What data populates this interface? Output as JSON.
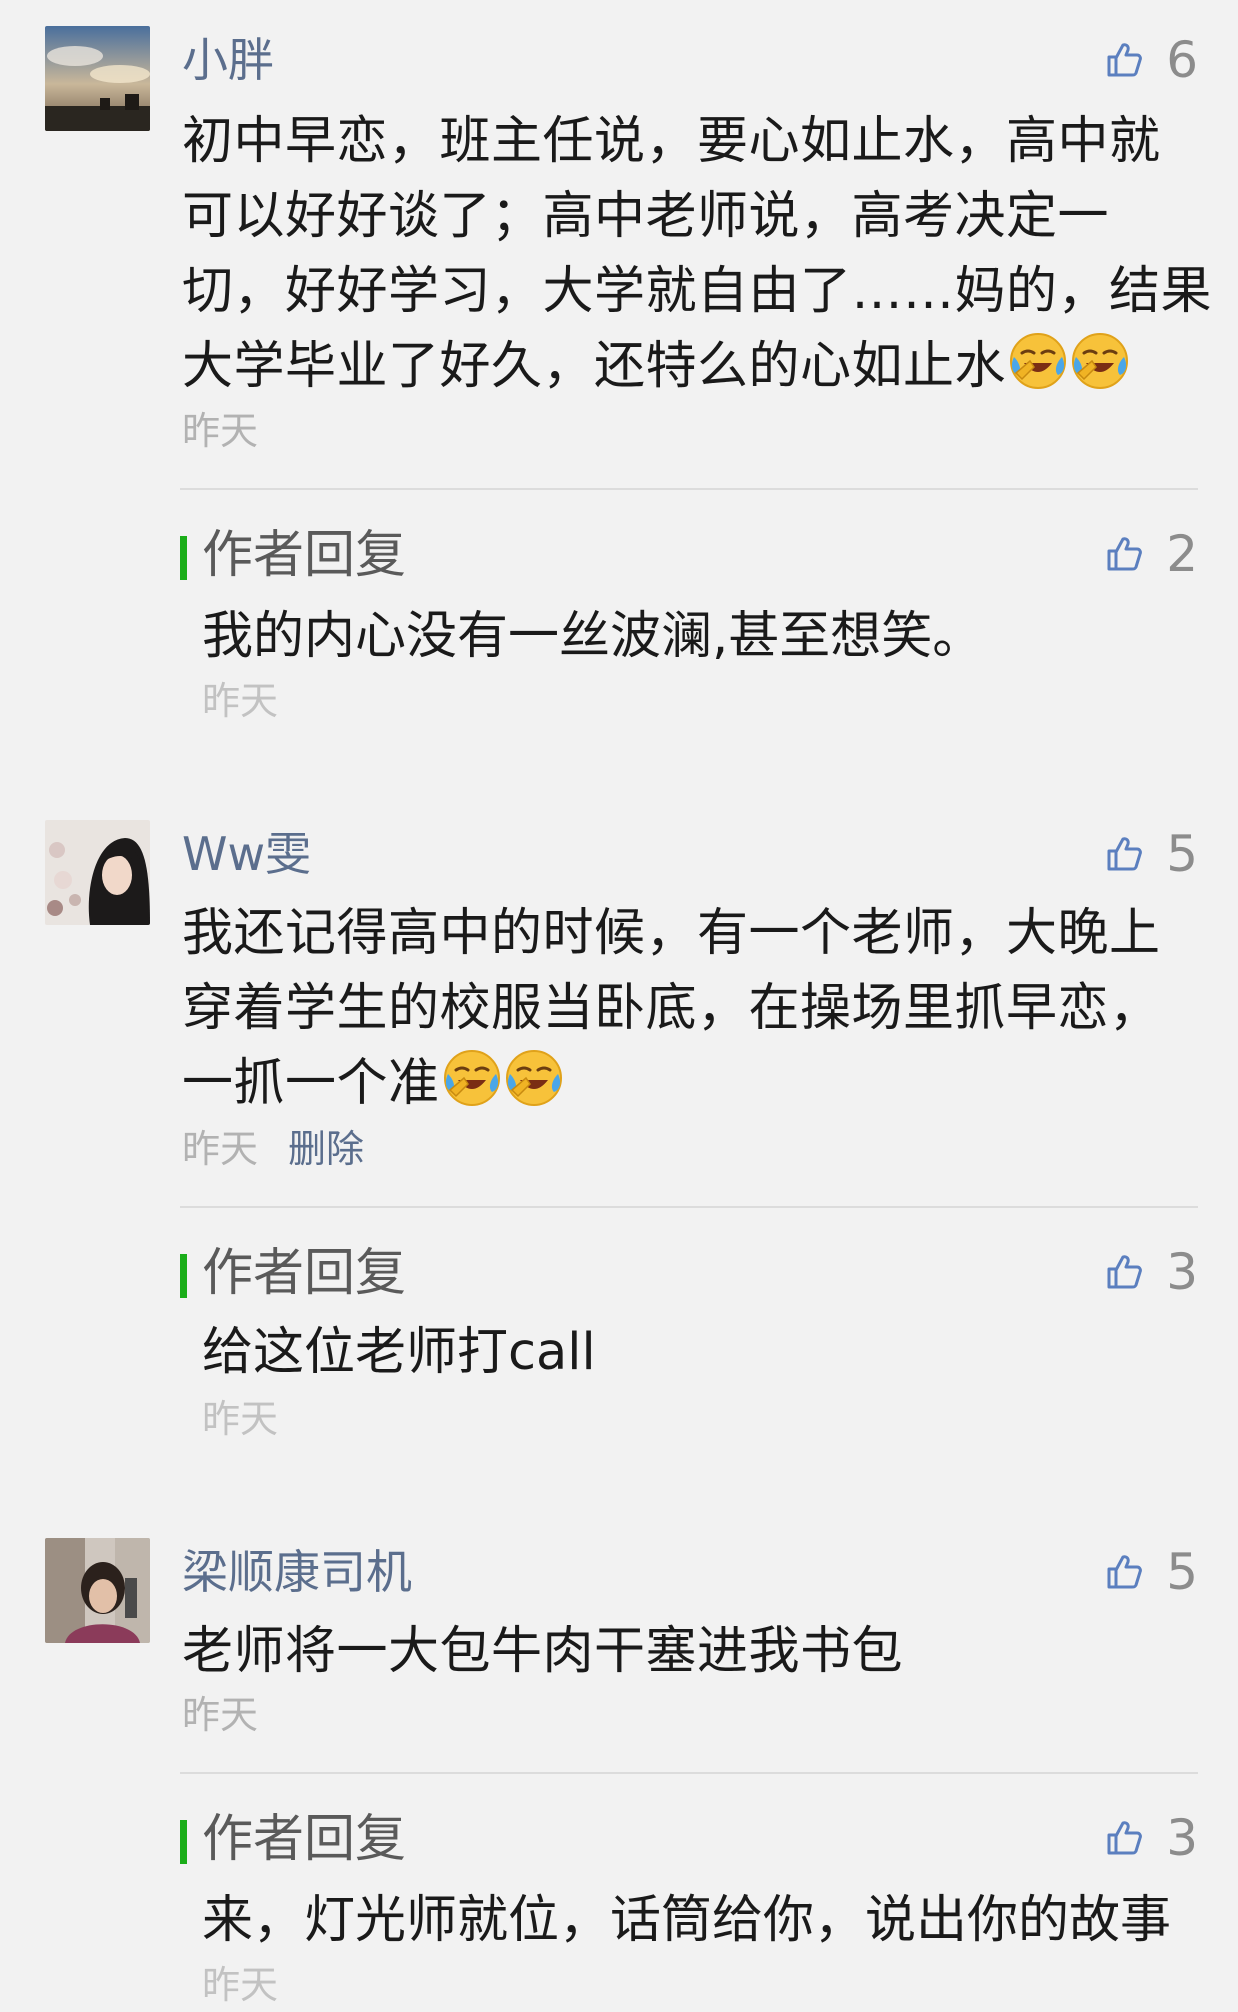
{
  "comments": [
    {
      "name": "小胖",
      "likes": "6",
      "lines": [
        "初中早恋，班主任说，要心如止水，高中就",
        "可以好好谈了；高中老师说，高考决定一",
        "切，好好学习，大学就自由了……妈的，结果",
        "大学毕业了好久，还特么的心如止水"
      ],
      "time": "昨天",
      "reply": {
        "label": "作者回复",
        "text": "我的内心没有一丝波澜,甚至想笑。",
        "time": "昨天",
        "likes": "2"
      }
    },
    {
      "name": "Ww雯",
      "likes": "5",
      "lines": [
        "我还记得高中的时候，有一个老师，大晚上",
        "穿着学生的校服当卧底，在操场里抓早恋，",
        "一抓一个准"
      ],
      "time": "昨天",
      "delete_label": "删除",
      "reply": {
        "label": "作者回复",
        "text": "给这位老师打call",
        "time": "昨天",
        "likes": "3"
      }
    },
    {
      "name": "梁顺康司机",
      "likes": "5",
      "lines": [
        "老师将一大包牛肉干塞进我书包"
      ],
      "time": "昨天",
      "reply": {
        "label": "作者回复",
        "text": "来，灯光师就位，话筒给你，说出你的故事",
        "time": "昨天",
        "likes": "3"
      }
    }
  ],
  "icons": {
    "like": "thumbs-up-icon",
    "emoji": "crying-laughing-face-icon"
  },
  "colors": {
    "background": "#f2f2f2",
    "nickname": "#5b6e8d",
    "reply_accent": "#1aad19",
    "meta": "#b2b2b2"
  }
}
